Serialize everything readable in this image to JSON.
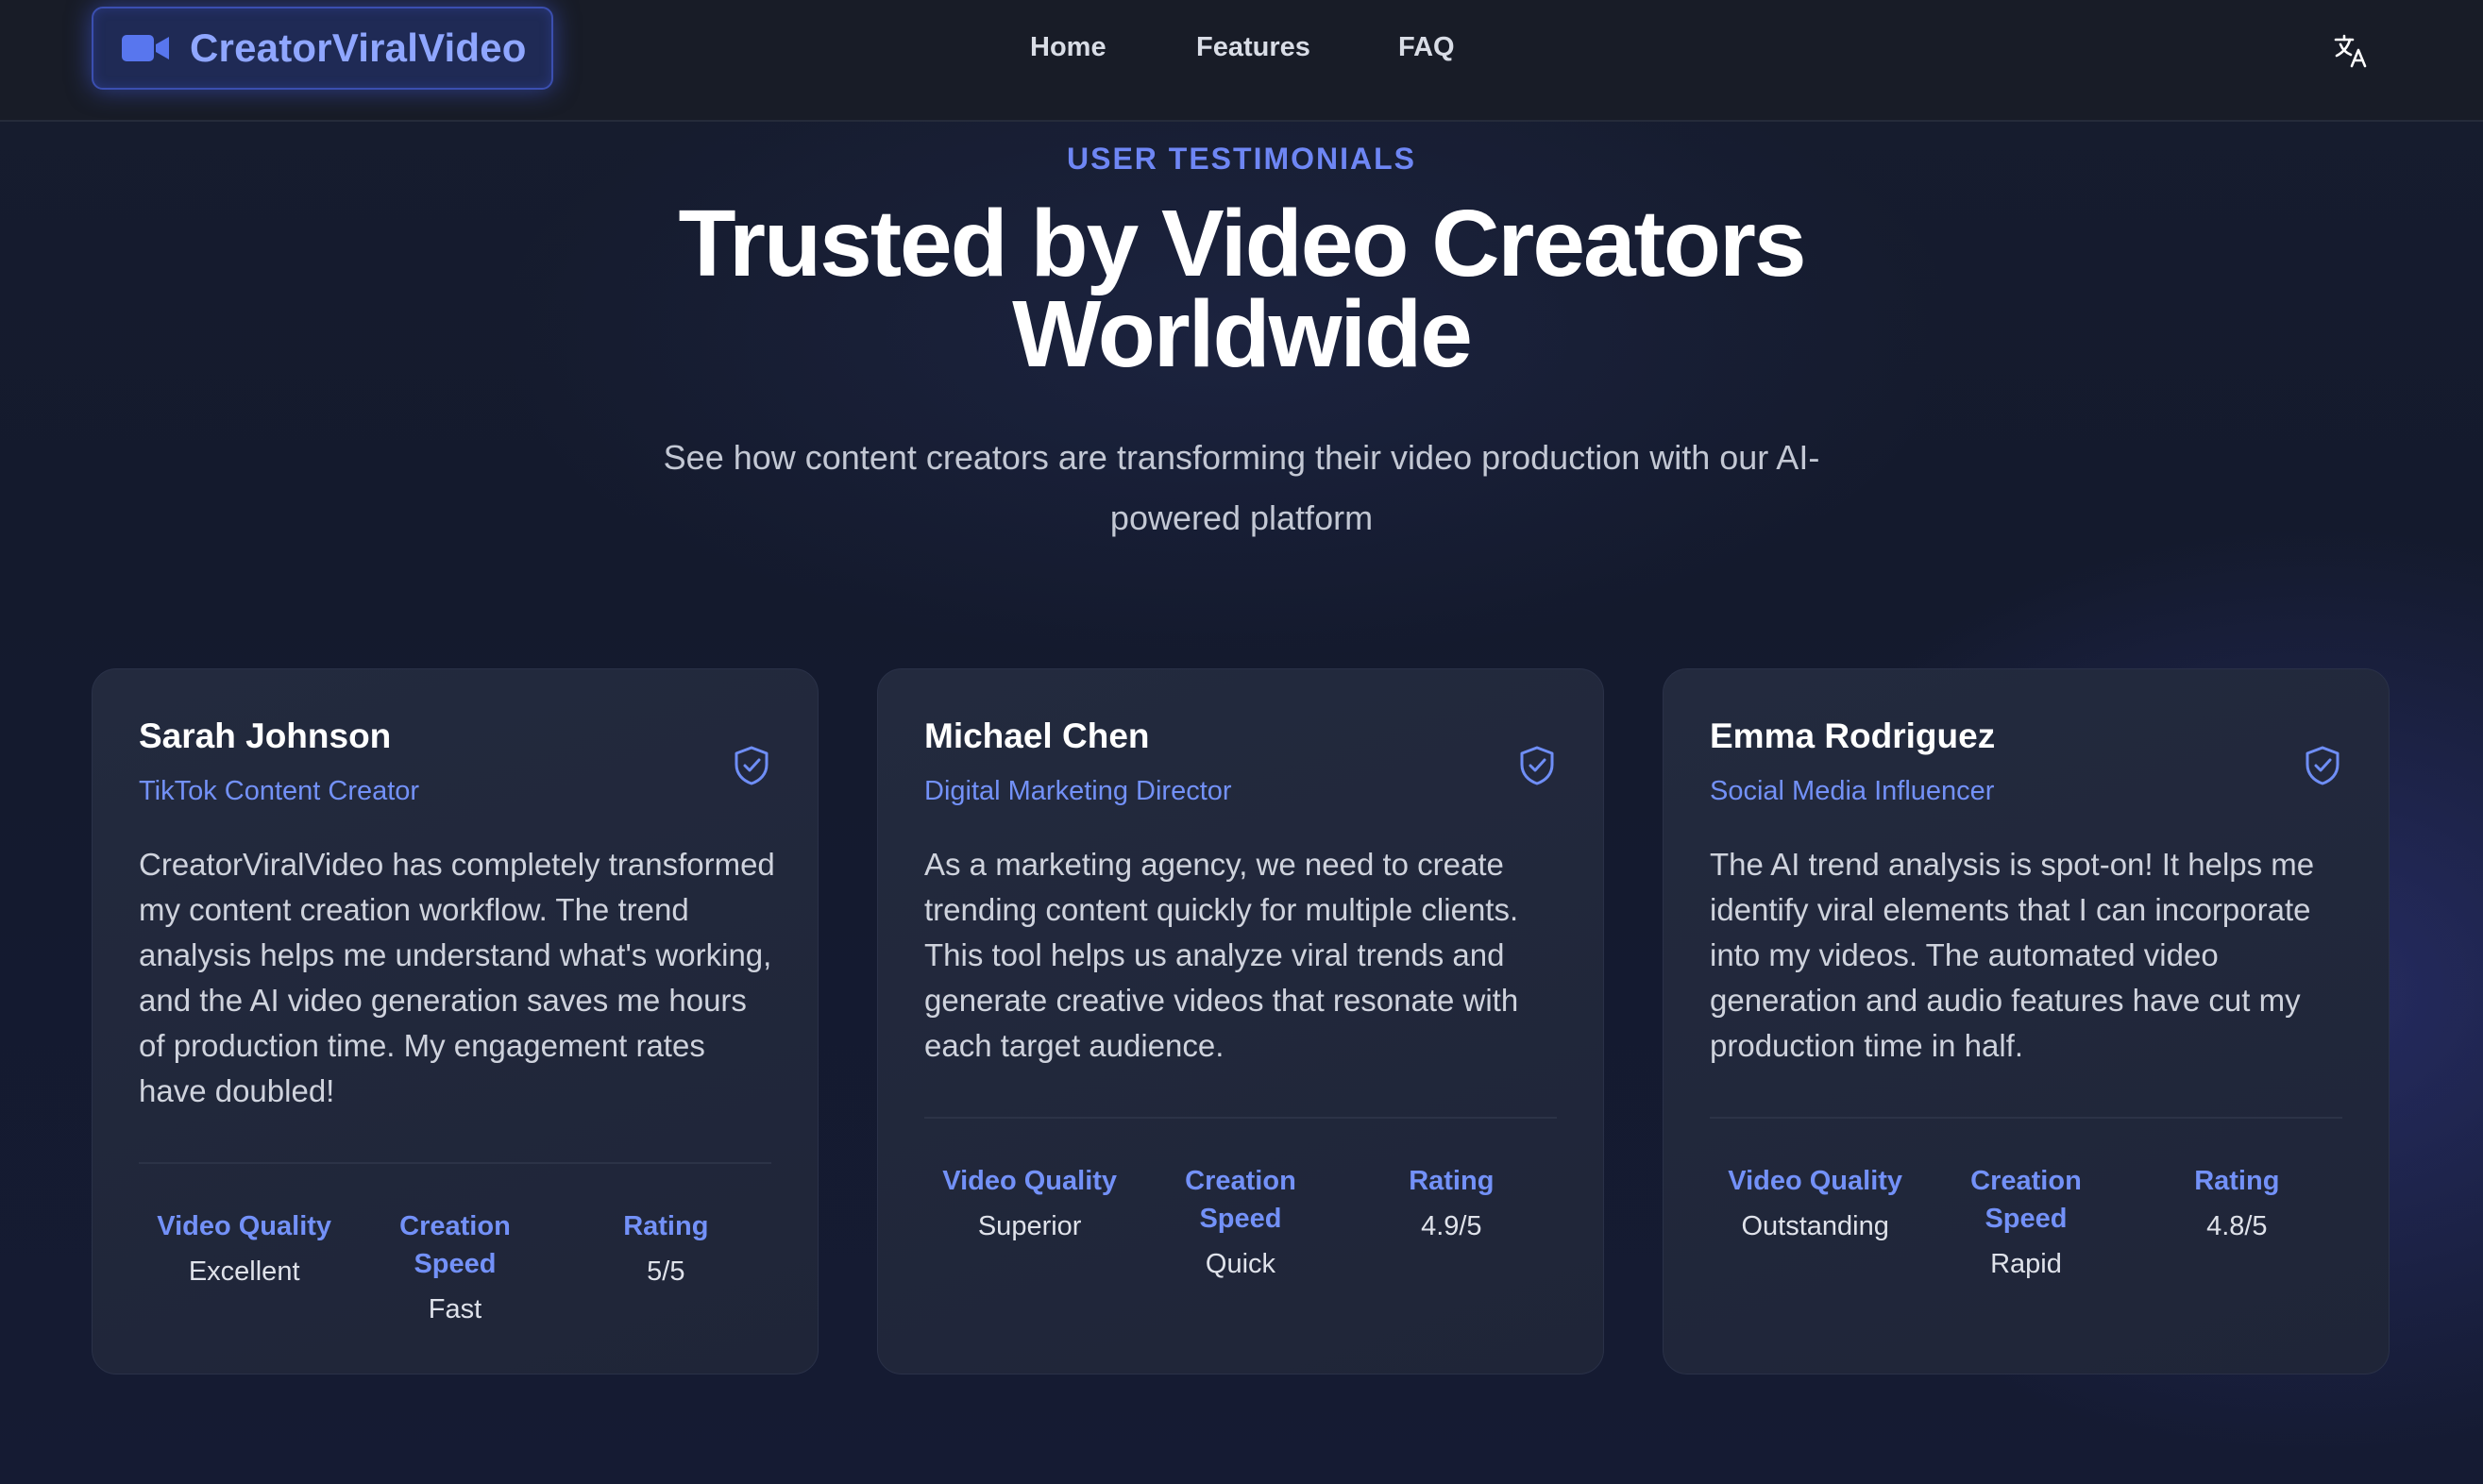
{
  "nav": {
    "logo_text": "CreatorViralVideo",
    "logo_icon": "video-camera-icon",
    "links": [
      "Home",
      "Features",
      "FAQ"
    ],
    "language_icon": "translate-icon"
  },
  "hero": {
    "eyebrow": "USER TESTIMONIALS",
    "title": "Trusted by Video Creators Worldwide",
    "subtitle": "See how content creators are transforming their video production with our AI-powered platform"
  },
  "colors": {
    "accent": "#7391f8",
    "eyebrow": "#6e86f4",
    "background": "#151b2e",
    "card": "#222a3d"
  },
  "testimonials": [
    {
      "name": "Sarah Johnson",
      "role": "TikTok Content Creator",
      "quote": "CreatorViralVideo has completely transformed my content creation workflow. The trend analysis helps me understand what's working, and the AI video generation saves me hours of production time. My engagement rates have doubled!",
      "badge_icon": "shield-check-icon",
      "stats": [
        {
          "label": "Video Quality",
          "value": "Excellent"
        },
        {
          "label": "Creation Speed",
          "value": "Fast"
        },
        {
          "label": "Rating",
          "value": "5/5"
        }
      ]
    },
    {
      "name": "Michael Chen",
      "role": "Digital Marketing Director",
      "quote": "As a marketing agency, we need to create trending content quickly for multiple clients. This tool helps us analyze viral trends and generate creative videos that resonate with each target audience.",
      "badge_icon": "shield-check-icon",
      "stats": [
        {
          "label": "Video Quality",
          "value": "Superior"
        },
        {
          "label": "Creation Speed",
          "value": "Quick"
        },
        {
          "label": "Rating",
          "value": "4.9/5"
        }
      ]
    },
    {
      "name": "Emma Rodriguez",
      "role": "Social Media Influencer",
      "quote": "The AI trend analysis is spot-on! It helps me identify viral elements that I can incorporate into my videos. The automated video generation and audio features have cut my production time in half.",
      "badge_icon": "shield-check-icon",
      "stats": [
        {
          "label": "Video Quality",
          "value": "Outstanding"
        },
        {
          "label": "Creation Speed",
          "value": "Rapid"
        },
        {
          "label": "Rating",
          "value": "4.8/5"
        }
      ]
    }
  ]
}
